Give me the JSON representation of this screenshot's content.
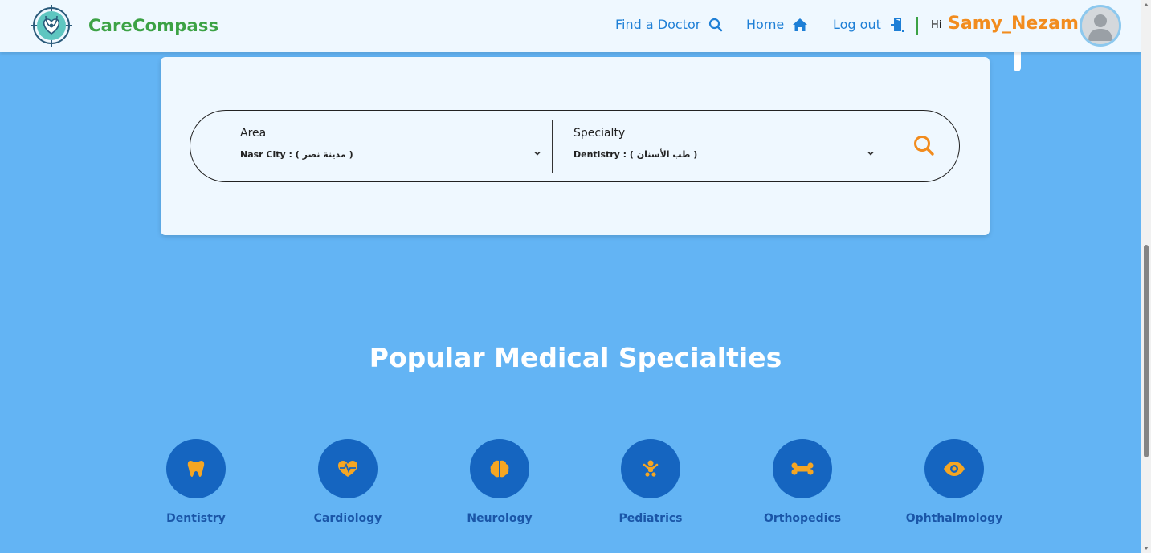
{
  "brand": {
    "name": "CareCompass",
    "icon": "stethoscope-heart-logo"
  },
  "nav": {
    "find_doctor": "Find a Doctor",
    "home": "Home",
    "logout": "Log out",
    "greeting": "Hi",
    "username": "Samy_Nezam"
  },
  "search": {
    "area_label": "Area",
    "area_value": "Nasr City : ( مدينة نصر )",
    "specialty_label": "Specialty",
    "specialty_value": "Dentistry : ( طب الأسنان )"
  },
  "section": {
    "title": "Popular Medical Specialties"
  },
  "specialties": [
    {
      "name": "Dentistry",
      "icon": "tooth-icon"
    },
    {
      "name": "Cardiology",
      "icon": "heartbeat-icon"
    },
    {
      "name": "Neurology",
      "icon": "brain-icon"
    },
    {
      "name": "Pediatrics",
      "icon": "baby-icon"
    },
    {
      "name": "Orthopedics",
      "icon": "bone-icon"
    },
    {
      "name": "Ophthalmology",
      "icon": "eye-icon"
    }
  ],
  "colors": {
    "background": "#63b4f4",
    "navbar": "#eff8ff",
    "brand_green": "#3ca245",
    "link_blue": "#1e7fd6",
    "accent_orange": "#f28c1e",
    "circle_blue": "#1565c0",
    "spec_text": "#1a56a8"
  }
}
